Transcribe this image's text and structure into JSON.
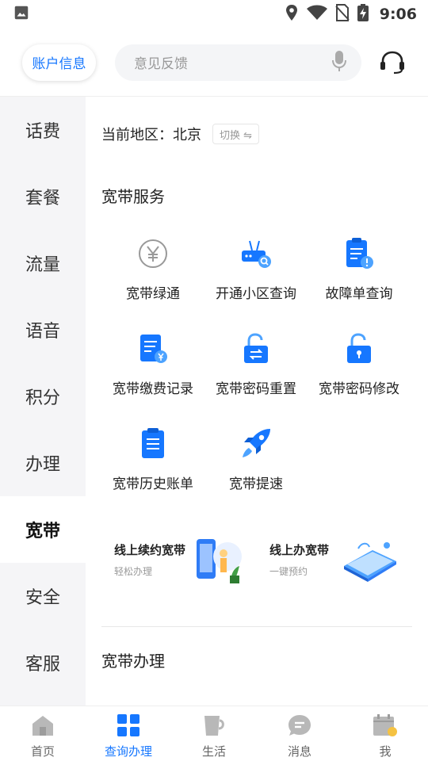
{
  "status_bar": {
    "time": "9:06"
  },
  "header": {
    "account_label": "账户信息",
    "search_placeholder": "意见反馈"
  },
  "sidebar": {
    "items": [
      {
        "label": "话费"
      },
      {
        "label": "套餐"
      },
      {
        "label": "流量"
      },
      {
        "label": "语音"
      },
      {
        "label": "积分"
      },
      {
        "label": "办理"
      },
      {
        "label": "宽带",
        "active": true
      },
      {
        "label": "安全"
      },
      {
        "label": "客服"
      }
    ]
  },
  "main": {
    "region_label": "当前地区：",
    "region_value": "北京",
    "switch_label": "切换 ⇋",
    "broadband_service_title": "宽带服务",
    "services": [
      {
        "label": "宽带绿通",
        "icon": "yen-coin-icon"
      },
      {
        "label": "开通小区查询",
        "icon": "router-search-icon"
      },
      {
        "label": "故障单查询",
        "icon": "clipboard-alert-icon"
      },
      {
        "label": "宽带缴费记录",
        "icon": "bill-yen-icon"
      },
      {
        "label": "宽带密码重置",
        "icon": "unlock-swap-icon"
      },
      {
        "label": "宽带密码修改",
        "icon": "unlock-key-icon"
      },
      {
        "label": "宽带历史账单",
        "icon": "clipboard-list-icon"
      },
      {
        "label": "宽带提速",
        "icon": "rocket-icon"
      }
    ],
    "banners": [
      {
        "title": "线上续约宽带",
        "subtitle": "轻松办理"
      },
      {
        "title": "线上办宽带",
        "subtitle": "一键预约"
      }
    ],
    "broadband_handle_title": "宽带办理"
  },
  "bottom_nav": {
    "items": [
      {
        "label": "首页",
        "icon": "home-icon"
      },
      {
        "label": "查询办理",
        "icon": "grid-icon",
        "active": true
      },
      {
        "label": "生活",
        "icon": "cup-icon"
      },
      {
        "label": "消息",
        "icon": "message-icon"
      },
      {
        "label": "我",
        "icon": "calendar-sign-icon"
      }
    ]
  },
  "colors": {
    "accent": "#1677ff",
    "sidebar_bg": "#f5f5f7"
  }
}
